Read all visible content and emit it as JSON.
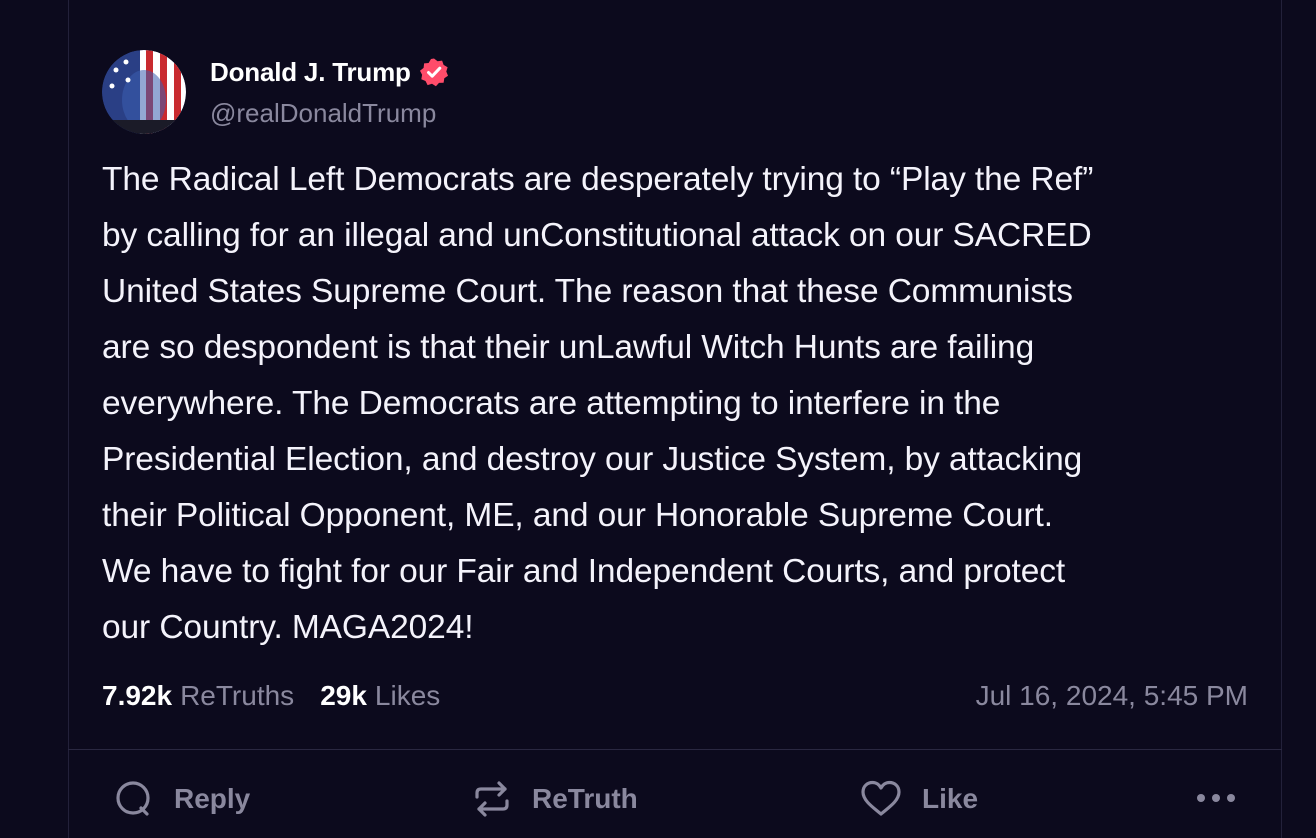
{
  "post": {
    "author_name": "Donald J. Trump",
    "author_handle": "@realDonaldTrump",
    "verified": true,
    "text": "The Radical Left Democrats are desperately trying to “Play the Ref”\nby calling for an illegal and unConstitutional attack on our SACRED\nUnited States Supreme Court. The reason that these Communists\nare so despondent is that their unLawful Witch Hunts are failing\neverywhere. The Democrats are attempting to interfere in the\nPresidential Election, and destroy our Justice System, by attacking\ntheir Political Opponent, ME, and our Honorable Supreme Court.\nWe have to fight for our Fair and Independent Courts, and protect\nour Country. MAGA2024!",
    "retruths_count": "7.92k",
    "retruths_label": "ReTruths",
    "likes_count": "29k",
    "likes_label": "Likes",
    "timestamp": "Jul 16, 2024, 5:45 PM"
  },
  "actions": {
    "reply": "Reply",
    "retruth": "ReTruth",
    "like": "Like"
  },
  "icons": {
    "avatar": "avatar-image",
    "verified": "verified-badge-icon",
    "reply": "speech-bubble-icon",
    "retruth": "repost-arrows-icon",
    "like": "heart-icon",
    "more": "more-dots-icon"
  },
  "colors": {
    "background": "#0c0a1d",
    "text": "#f4f3fb",
    "muted": "#8a889e",
    "verified": "#ff4c6a",
    "divider": "#2a2841"
  }
}
